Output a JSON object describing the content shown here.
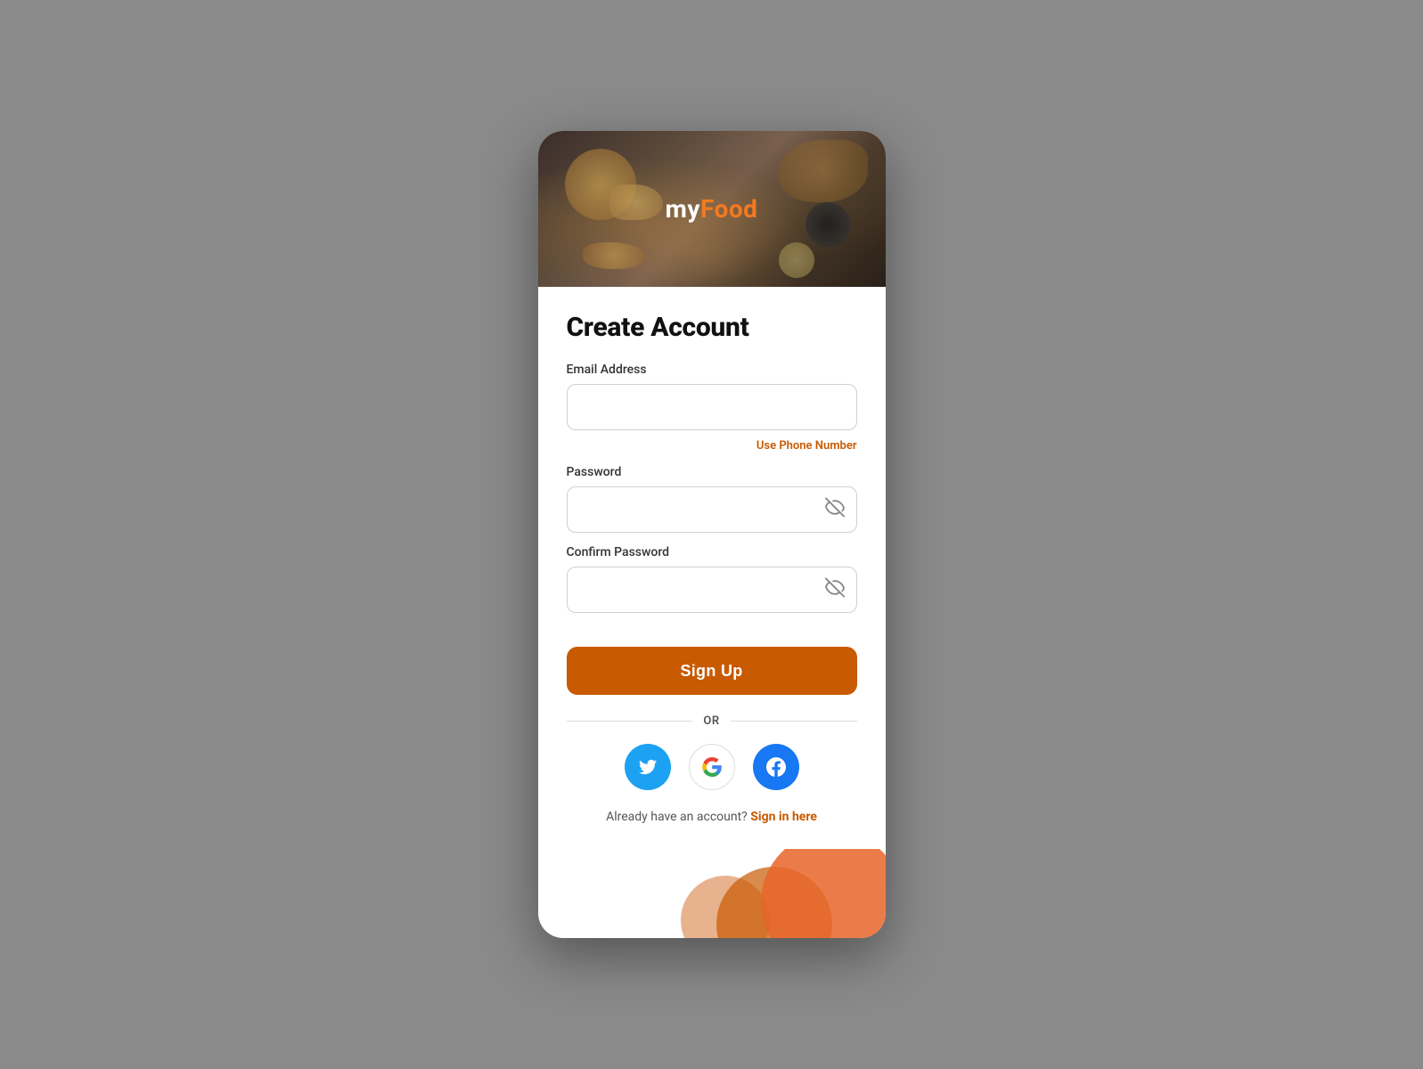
{
  "app": {
    "logo_my": "my",
    "logo_food": "Food"
  },
  "form": {
    "title": "Create Account",
    "email_label": "Email Address",
    "email_placeholder": "",
    "use_phone_link": "Use Phone Number",
    "password_label": "Password",
    "password_placeholder": "",
    "confirm_password_label": "Confirm Password",
    "confirm_password_placeholder": "",
    "signup_button": "Sign Up",
    "or_text": "OR",
    "signin_text": "Already have an account?",
    "signin_link": "Sign in here"
  },
  "social": {
    "twitter_label": "Twitter",
    "google_label": "Google",
    "facebook_label": "Facebook"
  }
}
